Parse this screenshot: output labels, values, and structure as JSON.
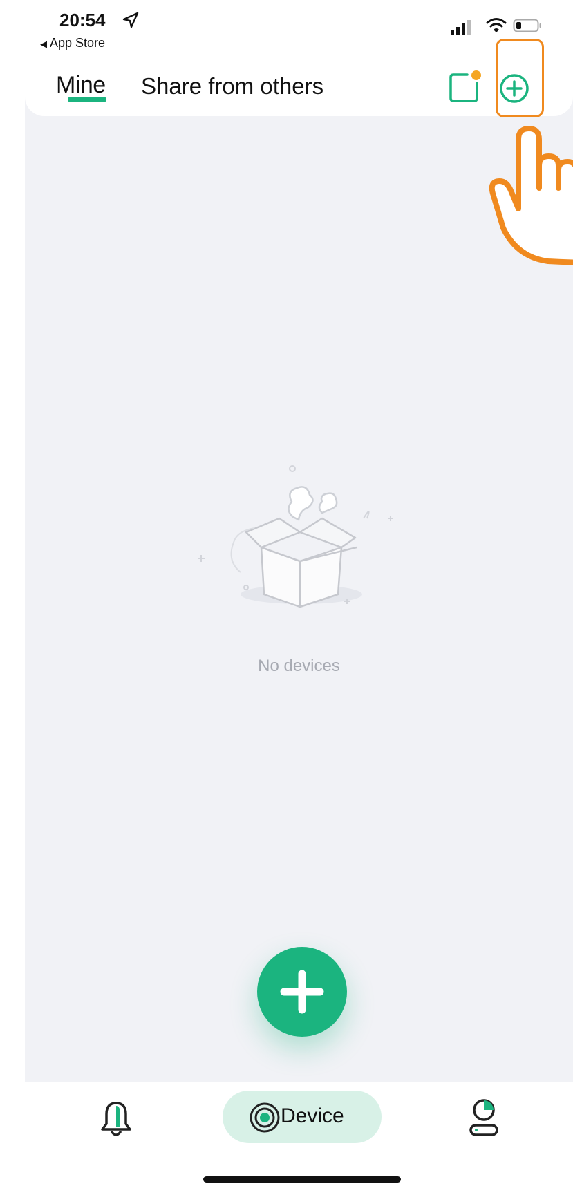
{
  "status_bar": {
    "time": "20:54",
    "back_app": "App Store",
    "icons": [
      "location-arrow-icon",
      "cellular-signal-icon",
      "wifi-icon",
      "battery-icon"
    ]
  },
  "header": {
    "tabs": [
      {
        "label": "Mine",
        "selected": true
      },
      {
        "label": "Share from others",
        "selected": false
      }
    ],
    "actions": [
      "scan-icon",
      "add-circle-icon"
    ]
  },
  "empty_state": {
    "icon": "empty-box-icon",
    "message": "No devices"
  },
  "fab": {
    "icon": "plus-icon"
  },
  "bottom_nav": {
    "items": [
      {
        "icon": "bell-icon",
        "label": ""
      },
      {
        "icon": "device-icon",
        "label": "Device",
        "active": true
      },
      {
        "icon": "profile-icon",
        "label": ""
      }
    ]
  },
  "colors": {
    "accent": "#1bb47f",
    "highlight": "#f08a1f",
    "background": "#f1f2f6",
    "nav_active_bg": "#d8f1e7",
    "muted_text": "#a7aab2"
  }
}
